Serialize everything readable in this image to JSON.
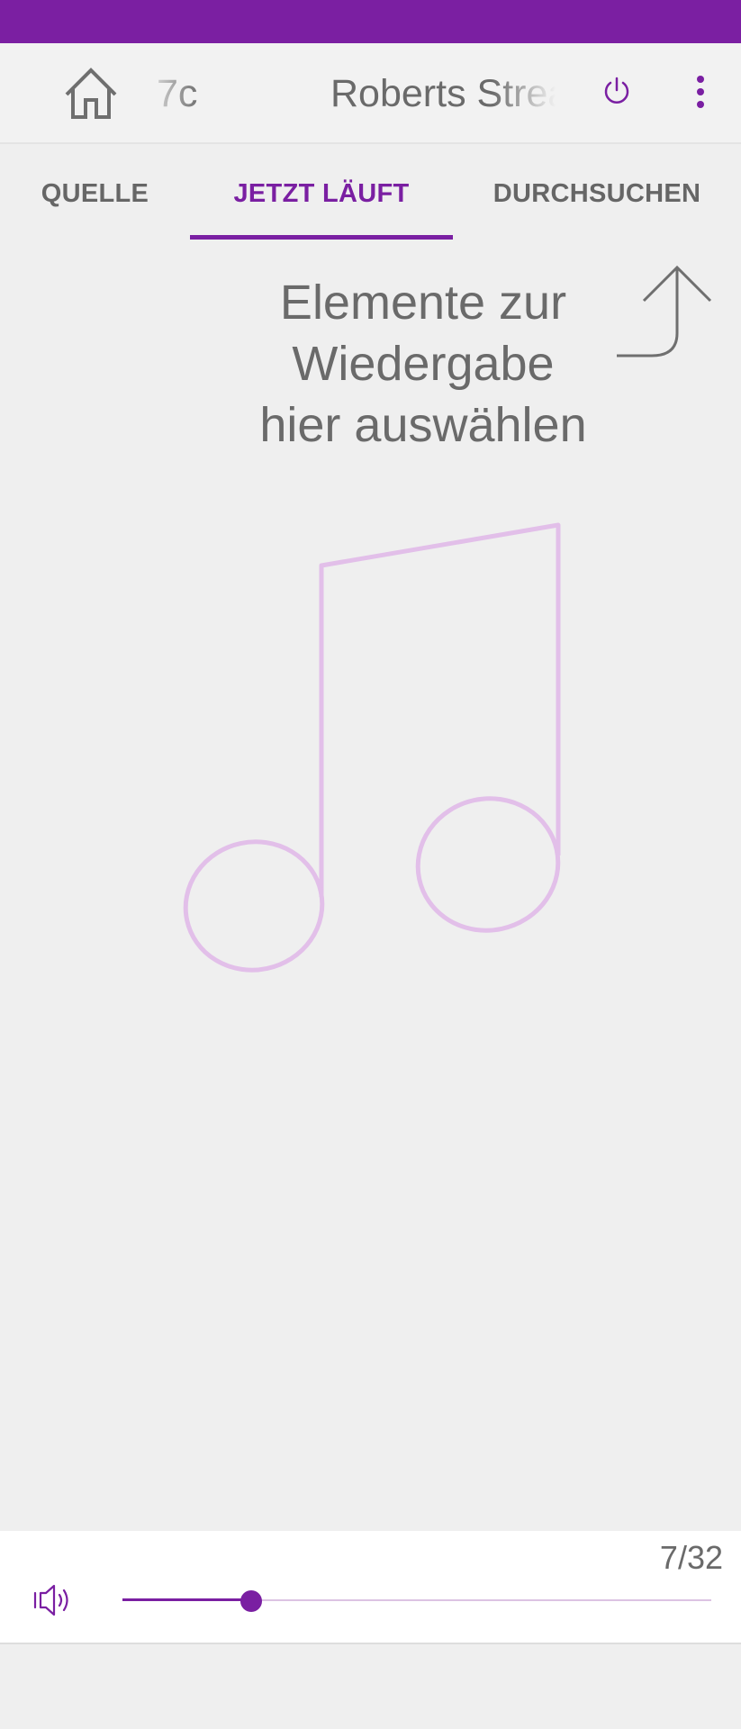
{
  "colors": {
    "brand": "#7a1fa2",
    "status_bar": "#7b1fa2",
    "icon_grey": "#6f6f6f",
    "text_grey": "#6a6a6a",
    "tab_inactive": "#666666",
    "note_outline": "#e2bfe9",
    "track_light": "#dcc3e3"
  },
  "toolbar": {
    "home_icon": "home-icon",
    "room_name": "7c",
    "device_name": "Roberts Stream",
    "power_icon": "power-icon",
    "menu_icon": "more-vertical-icon"
  },
  "tabs": [
    {
      "label": "QUELLE",
      "active": false
    },
    {
      "label": "JETZT LÄUFT",
      "active": true
    },
    {
      "label": "DURCHSUCHEN",
      "active": false
    }
  ],
  "now_playing": {
    "hint_lines": [
      "Elemente zur",
      "Wiedergabe",
      "hier auswählen"
    ],
    "hint_arrow_icon": "corner-up-arrow-icon",
    "placeholder_icon": "music-note-icon"
  },
  "player": {
    "volume_text": "7/32",
    "volume": 7,
    "volume_max": 32,
    "speaker_icon": "speaker-icon"
  }
}
